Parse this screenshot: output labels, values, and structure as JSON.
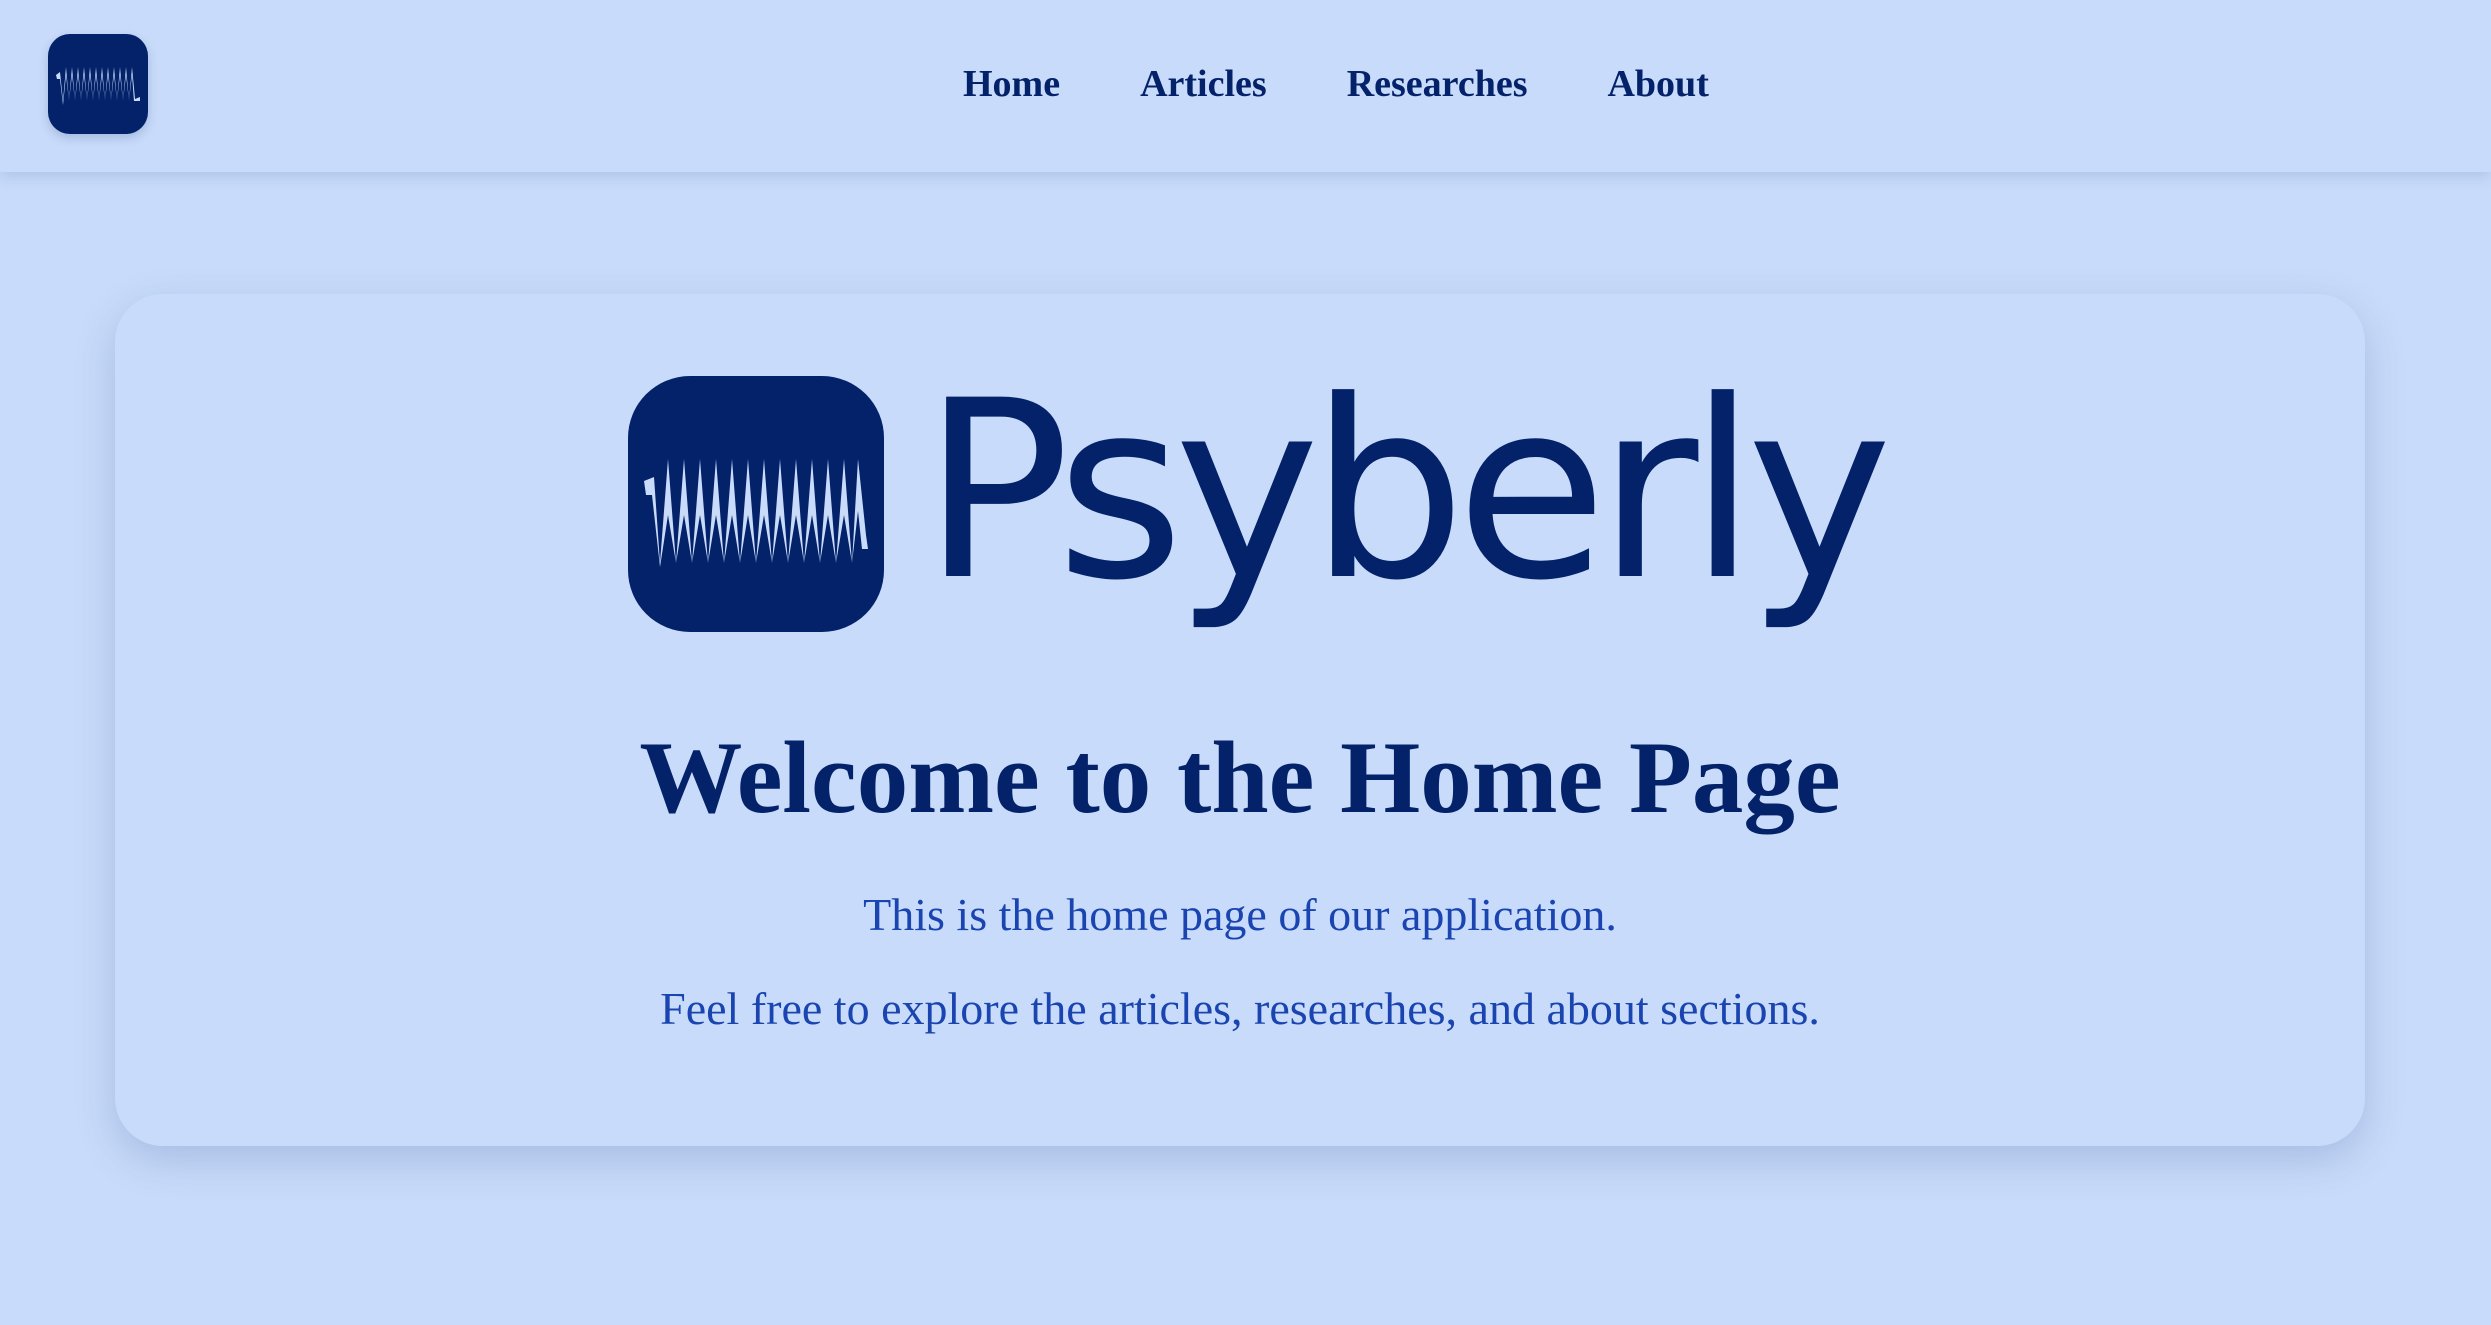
{
  "nav": {
    "logo_icon": "waveform-logo-icon",
    "links": [
      "Home",
      "Articles",
      "Researches",
      "About"
    ]
  },
  "hero": {
    "brand_icon": "waveform-logo-icon",
    "brand_name": "Psyberly",
    "heading": "Welcome to the Home Page",
    "paragraphs": [
      "This is the home page of our application.",
      "Feel free to explore the articles, researches, and about sections."
    ]
  },
  "colors": {
    "background": "#c8dbfa",
    "brand_dark": "#032269",
    "body_text": "#1a45b0",
    "waveform": "#c8dbfa"
  }
}
